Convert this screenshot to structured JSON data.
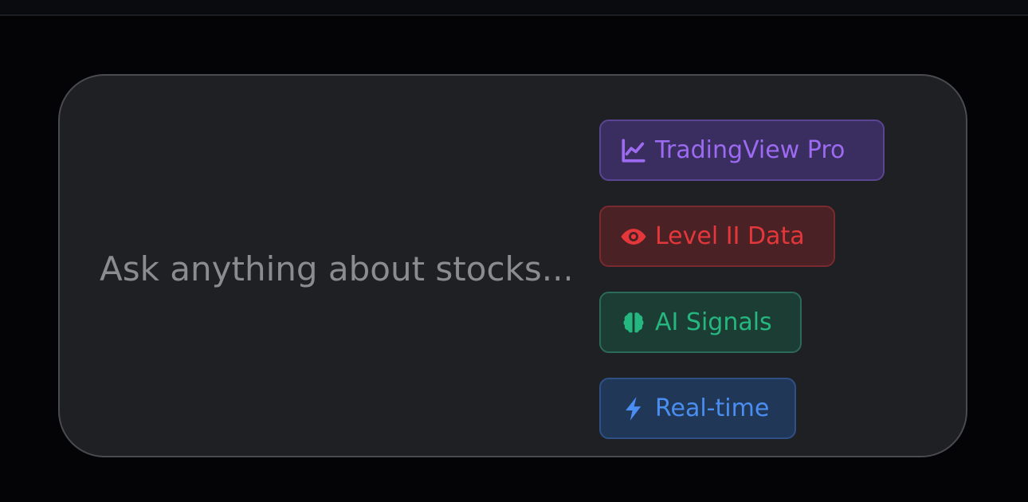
{
  "chat": {
    "placeholder": "Ask anything about stocks..."
  },
  "chips": [
    {
      "label": "TradingView Pro",
      "icon": "chart-line-icon",
      "color": "#9c6bf2"
    },
    {
      "label": "Level II Data",
      "icon": "eye-icon",
      "color": "#e4373b"
    },
    {
      "label": "AI Signals",
      "icon": "brain-icon",
      "color": "#25b77f"
    },
    {
      "label": "Real-time",
      "icon": "bolt-icon",
      "color": "#4a8ef2"
    }
  ]
}
